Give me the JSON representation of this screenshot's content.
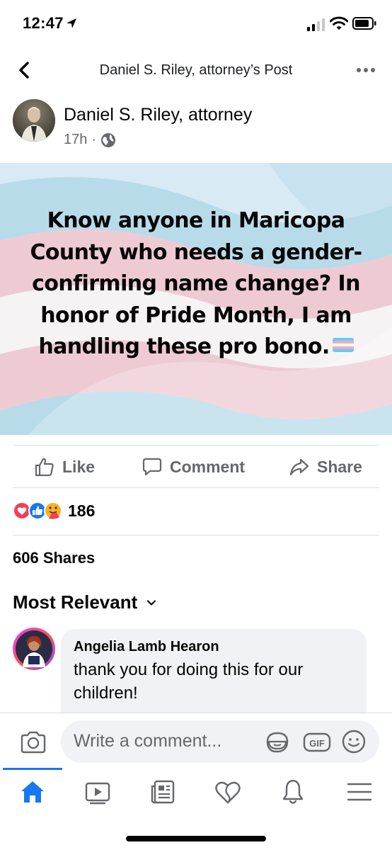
{
  "status_bar": {
    "time": "12:47"
  },
  "nav": {
    "title": "Daniel S. Riley, attorney’s Post"
  },
  "post": {
    "author": "Daniel S. Riley, attorney",
    "age": "17h",
    "meta_separator": "·",
    "image_text": "Know anyone in Maricopa County who needs a gender-confirming name change? In honor of Pride Month, I am handling these pro bono.",
    "flag_emoji": "transgender-flag-emoji"
  },
  "actions": {
    "like": "Like",
    "comment": "Comment",
    "share": "Share"
  },
  "reactions": {
    "count": "186",
    "types": [
      "love",
      "like",
      "care"
    ]
  },
  "shares": "606 Shares",
  "sort": {
    "label": "Most Relevant"
  },
  "comments": [
    {
      "author": "Angelia Lamb Hearon",
      "text": "thank you for doing this for our children!"
    }
  ],
  "composer": {
    "placeholder": "Write a comment..."
  },
  "tabs": [
    "home-icon",
    "watch-icon",
    "news-icon",
    "dating-icon",
    "notifications-icon",
    "menu-icon"
  ],
  "colors": {
    "accent": "#1877f2",
    "secondary_text": "#65676b",
    "bubble": "#f0f2f5",
    "love": "#f33e58",
    "care": "#f7b125"
  }
}
